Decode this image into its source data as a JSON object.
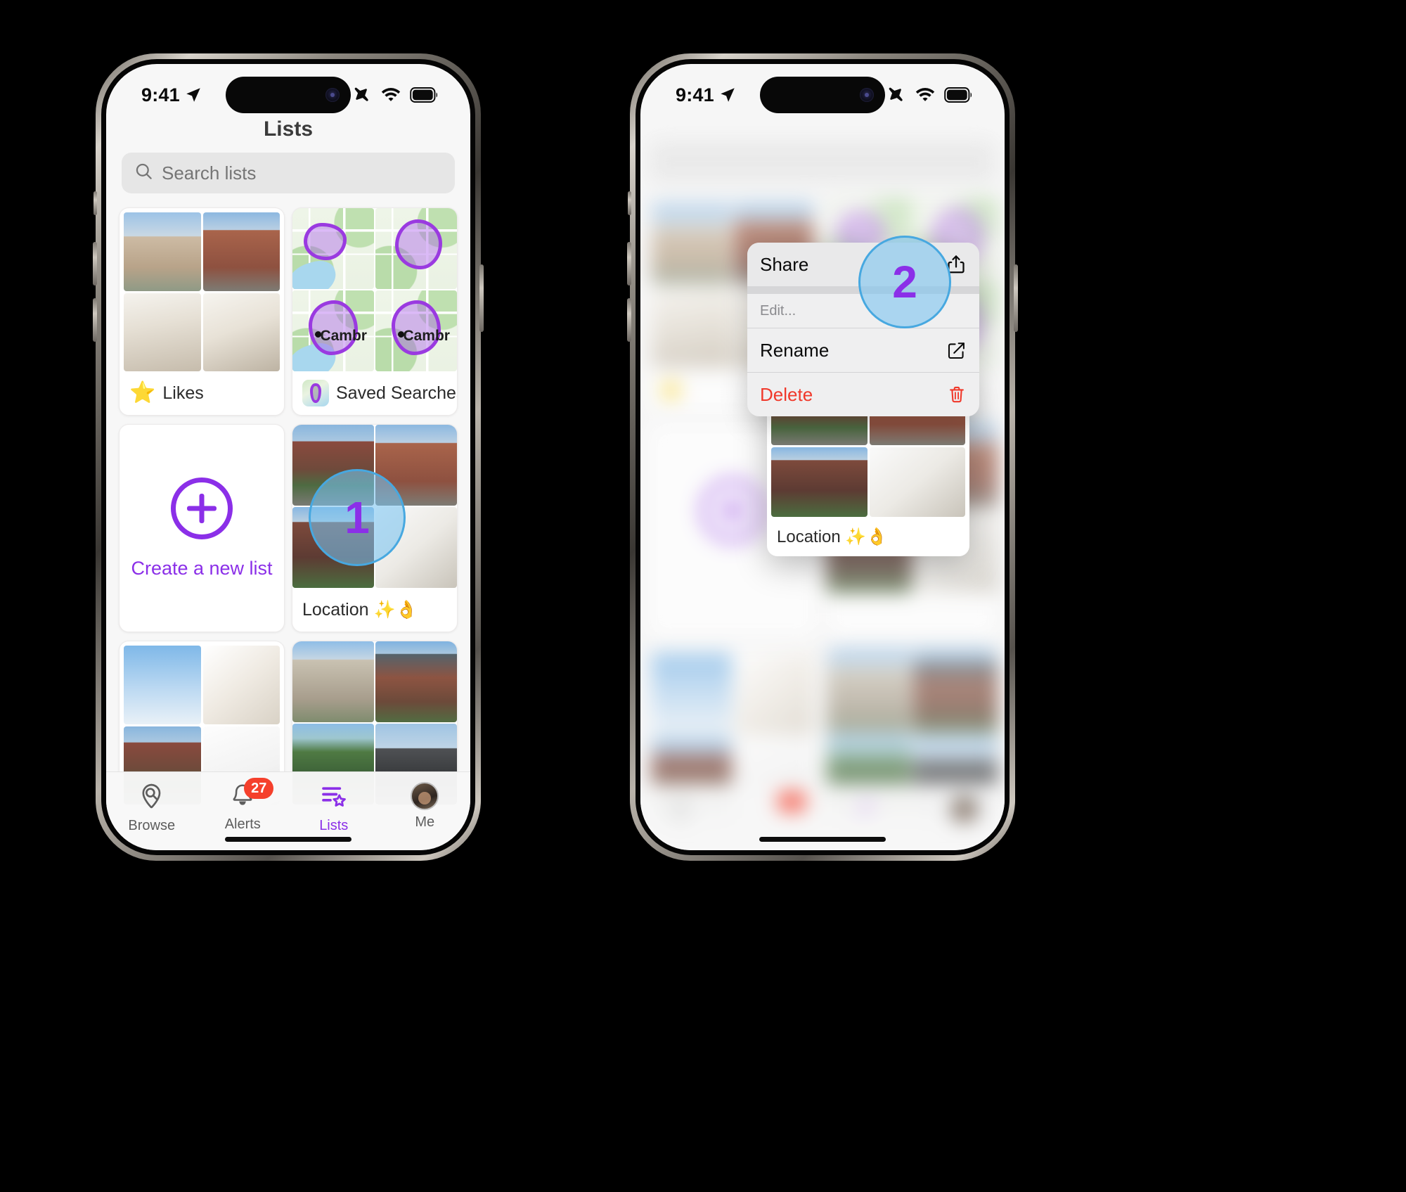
{
  "status_bar": {
    "time": "9:41",
    "location_arrow_icon": "location-arrow-icon",
    "airplane_icon": "airplane-mode-icon",
    "wifi_icon": "wifi-icon",
    "battery_icon": "battery-icon"
  },
  "screen_left": {
    "nav_title": "Lists",
    "search": {
      "placeholder": "Search lists",
      "value": "",
      "icon": "search-icon"
    },
    "cards": [
      {
        "id": "likes",
        "label": "Likes",
        "icon": "star-icon",
        "icon_color": "#f9ba21",
        "thumbs": [
          "house-exterior-beige",
          "house-exterior-brick-snow",
          "living-room",
          "kitchen-hallway"
        ]
      },
      {
        "id": "saved-searches",
        "label": "Saved Searches",
        "icon": "saved-search-map-icon",
        "thumbs": [
          "map-area-1",
          "map-area-2",
          "map-area-cambridge-1",
          "map-area-cambridge-2"
        ],
        "map_labels": [
          "Cambr",
          "Cambr"
        ]
      },
      {
        "id": "create-new-list",
        "label": "Create a new list",
        "icon": "plus-circle-icon",
        "accent": "#8b2fe8"
      },
      {
        "id": "location",
        "label": "Location ✨👌",
        "thumbs": [
          "brick-house-front",
          "brick-rowhouse-side",
          "victorian-house",
          "modern-interior"
        ]
      },
      {
        "id": "card-5",
        "label": "",
        "thumbs": [
          "sky-exterior",
          "empty-room-window",
          "red-brick-street",
          "blank"
        ]
      },
      {
        "id": "card-6",
        "label": "",
        "thumbs": [
          "stone-house",
          "blue-victorian",
          "green-victorian",
          "modern-garage"
        ]
      }
    ],
    "tabs": [
      {
        "label": "Browse",
        "icon": "browse-pin-search-icon",
        "active": false,
        "badge": ""
      },
      {
        "label": "Alerts",
        "icon": "bell-icon",
        "active": false,
        "badge": "27"
      },
      {
        "label": "Lists",
        "icon": "lists-star-icon",
        "active": true,
        "badge": ""
      },
      {
        "label": "Me",
        "icon": "avatar-icon",
        "active": false,
        "badge": ""
      }
    ],
    "accent_color": "#8b2fe8",
    "badge_color": "#f5402c"
  },
  "screen_right": {
    "context_menu": {
      "items": [
        {
          "label": "Share",
          "icon": "share-icon",
          "style": "default"
        },
        {
          "label": "Edit...",
          "icon": "",
          "style": "section-header"
        },
        {
          "label": "Rename",
          "icon": "pencil-square-icon",
          "style": "default"
        },
        {
          "label": "Delete",
          "icon": "trash-icon",
          "style": "destructive"
        }
      ]
    },
    "preview_card": {
      "label": "Location ✨👌",
      "thumbs": [
        "brick-house-front",
        "brick-rowhouse-side",
        "victorian-house",
        "modern-interior"
      ]
    }
  },
  "callouts": [
    {
      "number": "1",
      "on": "location-card-left-phone"
    },
    {
      "number": "2",
      "on": "share-menu-item-right-phone"
    }
  ]
}
